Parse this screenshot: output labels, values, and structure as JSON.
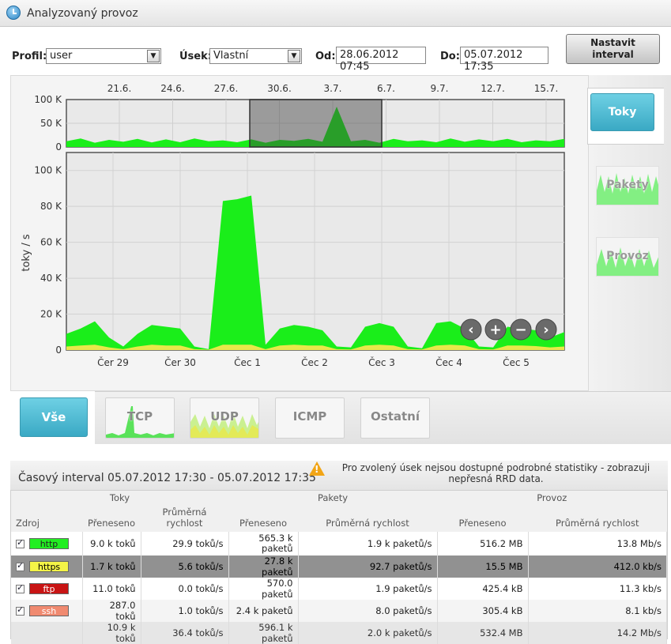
{
  "header": {
    "title": "Analyzovaný provoz"
  },
  "filters": {
    "profil_label": "Profil:",
    "profil_value": "user",
    "usek_label": "Úsek:",
    "usek_value": "Vlastní",
    "od_label": "Od:",
    "od_value": "28.06.2012 07:45",
    "do_label": "Do:",
    "do_value": "05.07.2012 17:35",
    "interval_button_line1": "Nastavit",
    "interval_button_line2": "interval"
  },
  "side_tabs": {
    "toky": "Toky",
    "pakety": "Pakety",
    "provoz": "Provoz"
  },
  "bottom_tabs": {
    "vse": "Vše",
    "tcp": "TCP",
    "udp": "UDP",
    "icmp": "ICMP",
    "ostatni": "Ostatní"
  },
  "colors": {
    "accent": "#45b6cf",
    "series_green": "#1aee1a",
    "series_yellow": "#e8e84a",
    "series_orange": "#f0a060"
  },
  "chart_data": [
    {
      "type": "area",
      "x_ticks": [
        "21.6.",
        "24.6.",
        "27.6.",
        "30.6.",
        "3.7.",
        "6.7.",
        "9.7.",
        "12.7.",
        "15.7."
      ],
      "y_ticks": [
        "0",
        "50 K",
        "100 K"
      ],
      "ylim": [
        0,
        100000
      ],
      "selected_range": [
        "28.06.2012 07:45",
        "05.07.2012 17:35"
      ],
      "series": [
        {
          "values": [
            12000,
            18000,
            9000,
            15000,
            11000,
            17000,
            9500,
            16000,
            10000,
            18000,
            12000,
            14000,
            10000,
            16000,
            9000,
            15000,
            13000,
            17000,
            11000,
            85000,
            12000,
            15000,
            9000,
            17000,
            12000,
            14000,
            10000,
            18000,
            11000,
            16000,
            12000,
            17000,
            10000,
            14000,
            12000,
            17000
          ]
        }
      ]
    },
    {
      "type": "area",
      "ylabel": "toky / s",
      "y_ticks": [
        "0",
        "20 K",
        "40 K",
        "60 K",
        "80 K",
        "100 K"
      ],
      "ylim": [
        0,
        100000
      ],
      "x_ticks": [
        "Čer 29",
        "Čer 30",
        "Čec 1",
        "Čec 2",
        "Čec 3",
        "Čec 4",
        "Čec 5"
      ],
      "series": [
        {
          "values": [
            9000,
            12000,
            16000,
            7000,
            2000,
            9000,
            14000,
            13000,
            12000,
            2000,
            500,
            83000,
            84000,
            86000,
            3000,
            12000,
            14000,
            13000,
            11000,
            2000,
            1500,
            13000,
            15000,
            13000,
            2000,
            1000,
            15000,
            16000,
            12000,
            2000,
            1500,
            13000,
            12000,
            11000,
            7000,
            10000
          ]
        },
        {
          "values": [
            2000,
            2500,
            3000,
            1500,
            500,
            2000,
            3000,
            2500,
            2500,
            500,
            200,
            3000,
            3000,
            3000,
            500,
            2500,
            3000,
            2500,
            2500,
            500,
            300,
            2500,
            3000,
            2500,
            500,
            300,
            2500,
            3000,
            2500,
            500,
            300,
            2500,
            2500,
            2200,
            1500,
            2000
          ]
        }
      ]
    }
  ],
  "graph_nav_icons": [
    "chevron-left-icon",
    "zoom-in-icon",
    "zoom-out-icon",
    "chevron-right-icon"
  ],
  "stats": {
    "interval_title": "Časový interval 05.07.2012 17:30 - 05.07.2012 17:35",
    "warning": "Pro zvolený úsek nejsou dostupné podrobné statistiky - zobrazuji nepřesná RRD data.",
    "groups": {
      "toky": "Toky",
      "pakety": "Pakety",
      "provoz": "Provoz"
    },
    "columns": {
      "zdroj": "Zdroj",
      "prenes": "Přeneseno",
      "prum": "Průměrná rychlost",
      "prum_line1": "Průměrná",
      "prum_line2": "rychlost"
    },
    "rows": [
      {
        "name": "http",
        "color": "#22ee22",
        "toky_prenes": "9.0 k toků",
        "toky_rychl": "29.9 toků/s",
        "pakety_prenes": "565.3 k paketů",
        "pakety_rychl": "1.9 k paketů/s",
        "provoz_prenes": "516.2 MB",
        "provoz_rychl": "13.8 Mb/s"
      },
      {
        "name": "https",
        "color": "#f4f447",
        "toky_prenes": "1.7 k toků",
        "toky_rychl": "5.6 toků/s",
        "pakety_prenes": "27.8 k paketů",
        "pakety_rychl": "92.7 paketů/s",
        "provoz_prenes": "15.5 MB",
        "provoz_rychl": "412.0 kb/s"
      },
      {
        "name": "ftp",
        "color": "#c81414",
        "toky_prenes": "11.0 toků",
        "toky_rychl": "0.0 toků/s",
        "pakety_prenes": "570.0 paketů",
        "pakety_rychl": "1.9 paketů/s",
        "provoz_prenes": "425.4 kB",
        "provoz_rychl": "11.3 kb/s"
      },
      {
        "name": "ssh",
        "color": "#f08a70",
        "toky_prenes": "287.0 toků",
        "toky_rychl": "1.0 toků/s",
        "pakety_prenes": "2.4 k paketů",
        "pakety_rychl": "8.0 paketů/s",
        "provoz_prenes": "305.4 kB",
        "provoz_rychl": "8.1 kb/s"
      }
    ],
    "total": {
      "toky_prenes": "10.9 k toků",
      "toky_rychl": "36.4 toků/s",
      "pakety_prenes": "596.1 k paketů",
      "pakety_rychl": "2.0 k paketů/s",
      "provoz_prenes": "532.4 MB",
      "provoz_rychl": "14.2 Mb/s"
    }
  }
}
